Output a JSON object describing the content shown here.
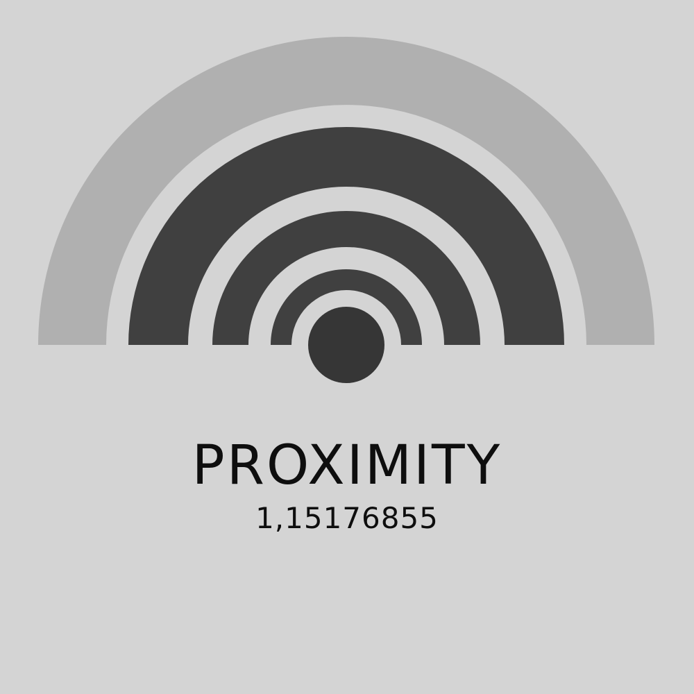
{
  "sensor": {
    "label": "PROXIMITY",
    "value": "1,15176855",
    "level_rings_active": 3,
    "level_rings_total": 4
  },
  "colors": {
    "background": "#d4d4d4",
    "ring_active": "#404040",
    "ring_inactive": "#b0b0b0",
    "center_dot": "#363636",
    "text": "#0e0e0e"
  },
  "icons": {
    "gauge": "proximity-signal-icon",
    "center": "center-dot-icon"
  }
}
